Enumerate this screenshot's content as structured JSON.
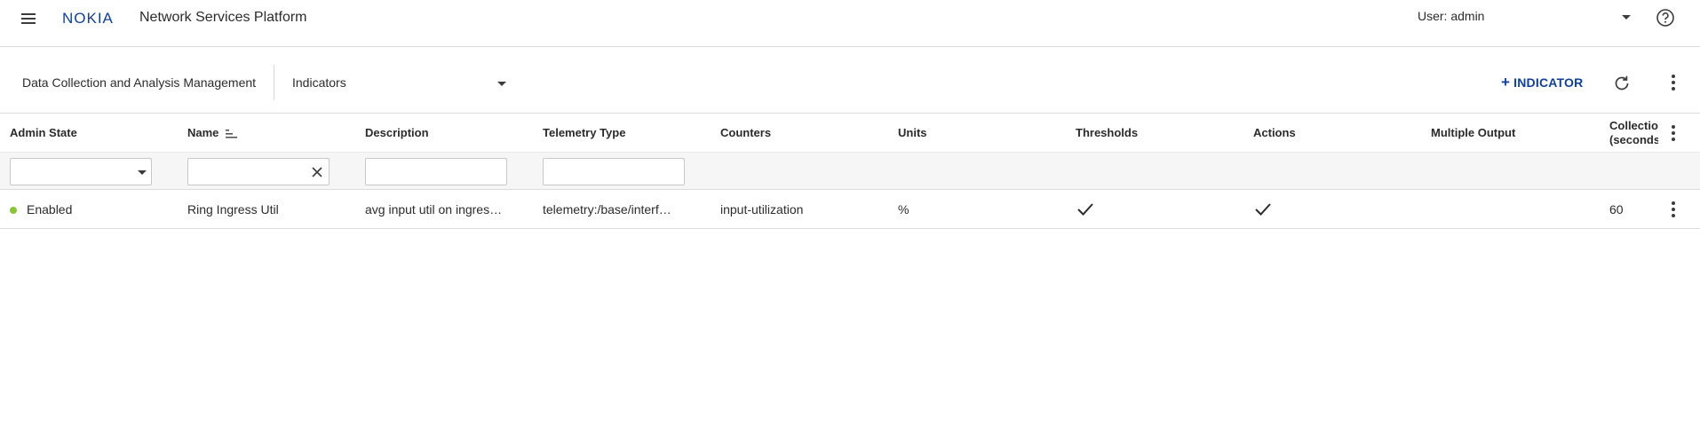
{
  "app": {
    "brand": "NOKIA",
    "title": "Network Services Platform",
    "user_label": "User: admin"
  },
  "icons": {
    "menu": "hamburger-icon",
    "help": "help-circle-icon",
    "refresh": "refresh-icon",
    "more": "more-vertical-icon",
    "sort": "sort-icon",
    "clear": "close-icon",
    "check": "checkmark-icon"
  },
  "colors": {
    "accent": "#124191",
    "status_enabled": "#8ac43f"
  },
  "toolbar": {
    "breadcrumb": "Data Collection and Analysis Management",
    "view_selected": "Indicators",
    "add_label": "INDICATOR"
  },
  "table": {
    "columns": [
      "Admin State",
      "Name",
      "Description",
      "Telemetry Type",
      "Counters",
      "Units",
      "Thresholds",
      "Actions",
      "Multiple Output"
    ],
    "last_column_line1": "Collectio",
    "last_column_line2": "(seconds",
    "rows": [
      {
        "admin_state": "Enabled",
        "name": "Ring Ingress Util",
        "description": "avg input util on ingres…",
        "telemetry_type": "telemetry:/base/interf…",
        "counters": "input-utilization",
        "units": "%",
        "thresholds": true,
        "actions": true,
        "multiple_output": "",
        "collection_interval": "60"
      }
    ]
  }
}
